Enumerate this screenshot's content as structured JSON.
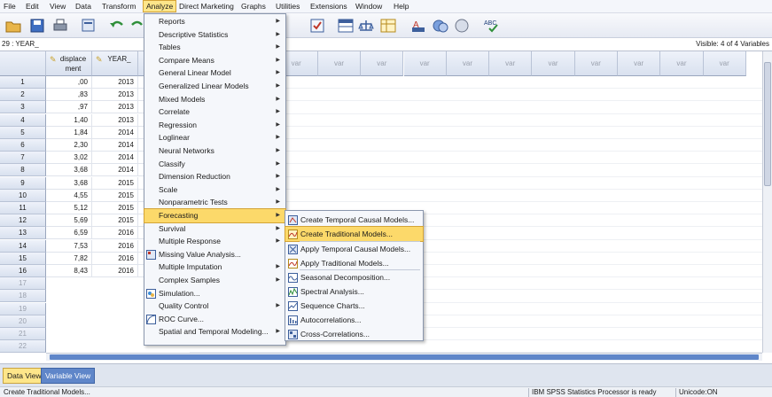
{
  "menubar": {
    "items": [
      "File",
      "Edit",
      "View",
      "Data",
      "Transform",
      "Analyze",
      "Direct Marketing",
      "Graphs",
      "Utilities",
      "Extensions",
      "Window",
      "Help"
    ],
    "active": "Analyze"
  },
  "toolbar": {
    "icons": [
      "open-icon",
      "save-icon",
      "print-icon",
      "dialog-recall-icon",
      "undo-icon",
      "redo-icon",
      "goto-case-icon",
      "variables-icon",
      "run-descriptives-icon",
      "find-icon",
      "insert-cases-icon",
      "split-file-icon",
      "weight-cases-icon",
      "select-cases-icon",
      "value-labels-icon",
      "use-sets-icon",
      "show-all-icon",
      "spell-check-icon"
    ]
  },
  "cellinfo": {
    "ref": "29 : YEAR_",
    "visible": "Visible: 4 of 4 Variables"
  },
  "grid": {
    "columns": [
      {
        "name": "displace ment",
        "line1": "displace",
        "line2": "ment"
      },
      {
        "name": "YEAR_",
        "line1": "YEAR_",
        "line2": ""
      },
      {
        "name": "",
        "line1": "",
        "line2": ""
      }
    ],
    "var_label": "var",
    "rows": [
      {
        "n": "1",
        "a": ",00",
        "b": "2013"
      },
      {
        "n": "2",
        "a": ",83",
        "b": "2013"
      },
      {
        "n": "3",
        "a": ",97",
        "b": "2013"
      },
      {
        "n": "4",
        "a": "1,40",
        "b": "2013"
      },
      {
        "n": "5",
        "a": "1,84",
        "b": "2014"
      },
      {
        "n": "6",
        "a": "2,30",
        "b": "2014"
      },
      {
        "n": "7",
        "a": "3,02",
        "b": "2014"
      },
      {
        "n": "8",
        "a": "3,68",
        "b": "2014"
      },
      {
        "n": "9",
        "a": "3,68",
        "b": "2015"
      },
      {
        "n": "10",
        "a": "4,55",
        "b": "2015"
      },
      {
        "n": "11",
        "a": "5,12",
        "b": "2015"
      },
      {
        "n": "12",
        "a": "5,69",
        "b": "2015"
      },
      {
        "n": "13",
        "a": "6,59",
        "b": "2016"
      },
      {
        "n": "14",
        "a": "7,53",
        "b": "2016"
      },
      {
        "n": "15",
        "a": "7,82",
        "b": "2016"
      },
      {
        "n": "16",
        "a": "8,43",
        "b": "2016"
      }
    ],
    "empty_rows": [
      "17",
      "18",
      "19",
      "20",
      "21",
      "22"
    ]
  },
  "analyze_menu": [
    {
      "label": "Reports",
      "sub": true
    },
    {
      "label": "Descriptive Statistics",
      "sub": true
    },
    {
      "label": "Tables",
      "sub": true
    },
    {
      "label": "Compare Means",
      "sub": true
    },
    {
      "label": "General Linear Model",
      "sub": true
    },
    {
      "label": "Generalized Linear Models",
      "sub": true
    },
    {
      "label": "Mixed Models",
      "sub": true
    },
    {
      "label": "Correlate",
      "sub": true
    },
    {
      "label": "Regression",
      "sub": true
    },
    {
      "label": "Loglinear",
      "sub": true
    },
    {
      "label": "Neural Networks",
      "sub": true
    },
    {
      "label": "Classify",
      "sub": true
    },
    {
      "label": "Dimension Reduction",
      "sub": true
    },
    {
      "label": "Scale",
      "sub": true
    },
    {
      "label": "Nonparametric Tests",
      "sub": true
    },
    {
      "label": "Forecasting",
      "sub": true,
      "highlight": true
    },
    {
      "label": "Survival",
      "sub": true
    },
    {
      "label": "Multiple Response",
      "sub": true
    },
    {
      "label": "Missing Value Analysis...",
      "sub": false,
      "icon": "missing-value-icon"
    },
    {
      "label": "Multiple Imputation",
      "sub": true
    },
    {
      "label": "Complex Samples",
      "sub": true
    },
    {
      "label": "Simulation...",
      "sub": false,
      "icon": "simulation-icon"
    },
    {
      "label": "Quality Control",
      "sub": true
    },
    {
      "label": "ROC Curve...",
      "sub": false,
      "icon": "roc-curve-icon"
    },
    {
      "label": "Spatial and Temporal Modeling...",
      "sub": true
    }
  ],
  "forecasting_menu": [
    {
      "label": "Create Temporal Causal Models...",
      "icon": "temporal-causal-icon"
    },
    {
      "label": "Create Traditional Models...",
      "icon": "traditional-model-icon",
      "highlight": true
    },
    {
      "label": "Apply Temporal Causal Models...",
      "icon": "apply-temporal-icon"
    },
    {
      "label": "Apply Traditional Models...",
      "icon": "apply-traditional-icon"
    },
    {
      "label": "Seasonal Decomposition...",
      "icon": "seasonal-icon"
    },
    {
      "label": "Spectral Analysis...",
      "icon": "spectral-icon"
    },
    {
      "label": "Sequence Charts...",
      "icon": "sequence-chart-icon"
    },
    {
      "label": "Autocorrelations...",
      "icon": "autocorrelation-icon"
    },
    {
      "label": "Cross-Correlations...",
      "icon": "cross-correlation-icon"
    }
  ],
  "tabs": {
    "data_view": "Data View",
    "variable_view": "Variable View"
  },
  "status": {
    "left": "Create Traditional Models...",
    "processor": "IBM SPSS Statistics Processor is ready",
    "encoding": "Unicode:ON"
  }
}
